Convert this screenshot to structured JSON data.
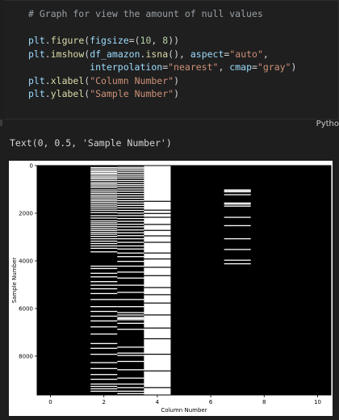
{
  "cell": {
    "lines": [
      [
        {
          "t": "# Graph for view the amount of null values",
          "c": "c-comment"
        }
      ],
      [],
      [
        {
          "t": "plt",
          "c": "c-var"
        },
        {
          "t": "."
        },
        {
          "t": "figure",
          "c": "c-fn"
        },
        {
          "t": "("
        },
        {
          "t": "figsize",
          "c": "c-var"
        },
        {
          "t": "=("
        },
        {
          "t": "10",
          "c": "c-num"
        },
        {
          "t": ", "
        },
        {
          "t": "8",
          "c": "c-num"
        },
        {
          "t": "))"
        }
      ],
      [
        {
          "t": "plt",
          "c": "c-var"
        },
        {
          "t": "."
        },
        {
          "t": "imshow",
          "c": "c-fn"
        },
        {
          "t": "("
        },
        {
          "t": "df_amazon",
          "c": "c-var"
        },
        {
          "t": "."
        },
        {
          "t": "isna",
          "c": "c-fn"
        },
        {
          "t": "(), "
        },
        {
          "t": "aspect",
          "c": "c-var"
        },
        {
          "t": "="
        },
        {
          "t": "\"auto\"",
          "c": "c-str"
        },
        {
          "t": ","
        }
      ],
      [
        {
          "t": "           "
        },
        {
          "t": "interpolation",
          "c": "c-var"
        },
        {
          "t": "="
        },
        {
          "t": "\"nearest\"",
          "c": "c-str"
        },
        {
          "t": ", "
        },
        {
          "t": "cmap",
          "c": "c-var"
        },
        {
          "t": "="
        },
        {
          "t": "\"gray\"",
          "c": "c-str"
        },
        {
          "t": ")"
        }
      ],
      [
        {
          "t": "plt",
          "c": "c-var"
        },
        {
          "t": "."
        },
        {
          "t": "xlabel",
          "c": "c-fn"
        },
        {
          "t": "("
        },
        {
          "t": "\"Column Number\"",
          "c": "c-str"
        },
        {
          "t": ")"
        }
      ],
      [
        {
          "t": "plt",
          "c": "c-var"
        },
        {
          "t": "."
        },
        {
          "t": "ylabel",
          "c": "c-fn"
        },
        {
          "t": "("
        },
        {
          "t": "\"Sample Number\"",
          "c": "c-str"
        },
        {
          "t": ")"
        }
      ]
    ],
    "language": "Pytho"
  },
  "output": {
    "text": "Text(0, 0.5, 'Sample Number')"
  },
  "chart_data": {
    "type": "heatmap",
    "title": "",
    "xlabel": "Column Number",
    "ylabel": "Sample Number",
    "xticks": [
      0,
      2,
      4,
      6,
      8,
      10
    ],
    "yticks": [
      0,
      2000,
      4000,
      6000,
      8000
    ],
    "xlim": [
      -0.5,
      10.5
    ],
    "ylim": [
      9630,
      -0.5
    ],
    "cmap": "gray",
    "columns": [
      {
        "col": 0,
        "null_rows": []
      },
      {
        "col": 1,
        "null_rows": []
      },
      {
        "col": 2,
        "null_rows": [
          60,
          120,
          190,
          240,
          300,
          350,
          420,
          480,
          540,
          610,
          700,
          760,
          830,
          900,
          1000,
          1080,
          1150,
          1230,
          1300,
          1380,
          1450,
          1520,
          1600,
          1680,
          1760,
          1850,
          1950,
          2080,
          2180,
          2300,
          2380,
          2460,
          2540,
          2620,
          2700,
          2780,
          2860,
          2950,
          3050,
          3150,
          3250,
          3350,
          3450,
          3600,
          4200,
          4300,
          4500,
          4650,
          4850,
          5000,
          5150,
          5350,
          5600,
          5900,
          6100,
          6300,
          6500,
          6750,
          7050,
          7450,
          7650,
          7900,
          8250,
          8500,
          8750,
          8950,
          9150,
          9250,
          9350,
          9450
        ]
      },
      {
        "col": 3,
        "null_rows": [
          50,
          110,
          180,
          260,
          340,
          420,
          500,
          600,
          690,
          780,
          860,
          960,
          1050,
          1150,
          1250,
          1350,
          1450,
          1550,
          1650,
          1750,
          1860,
          1970,
          2080,
          2200,
          2320,
          2440,
          2550,
          2680,
          2800,
          2920,
          3050,
          3200,
          3350,
          3480,
          3650,
          3800,
          4000,
          4200,
          4450,
          4700,
          5000,
          5300,
          5600,
          5900,
          6150,
          6250,
          6350,
          6400,
          6450,
          6600,
          6850,
          7600,
          7850,
          7950,
          8200,
          8550,
          8900,
          9150,
          9300,
          9450,
          9550
        ]
      },
      {
        "col": 4,
        "null_rows_full": true,
        "gaps": [
          1480,
          1850,
          1990,
          2150,
          2450,
          2700,
          2930,
          3200,
          3650,
          3900,
          4250,
          4600,
          5100,
          5400,
          5750,
          6250,
          6800,
          7250,
          7900,
          8600,
          9300
        ]
      },
      {
        "col": 5,
        "null_rows": []
      },
      {
        "col": 6,
        "null_rows": []
      },
      {
        "col": 7,
        "null_rows": [
          1000,
          1030,
          1080,
          1200,
          1550,
          1600,
          1680,
          2150,
          2500,
          3050,
          3500,
          3950,
          4100
        ]
      },
      {
        "col": 8,
        "null_rows": []
      },
      {
        "col": 9,
        "null_rows": []
      },
      {
        "col": 10,
        "null_rows": []
      }
    ]
  }
}
